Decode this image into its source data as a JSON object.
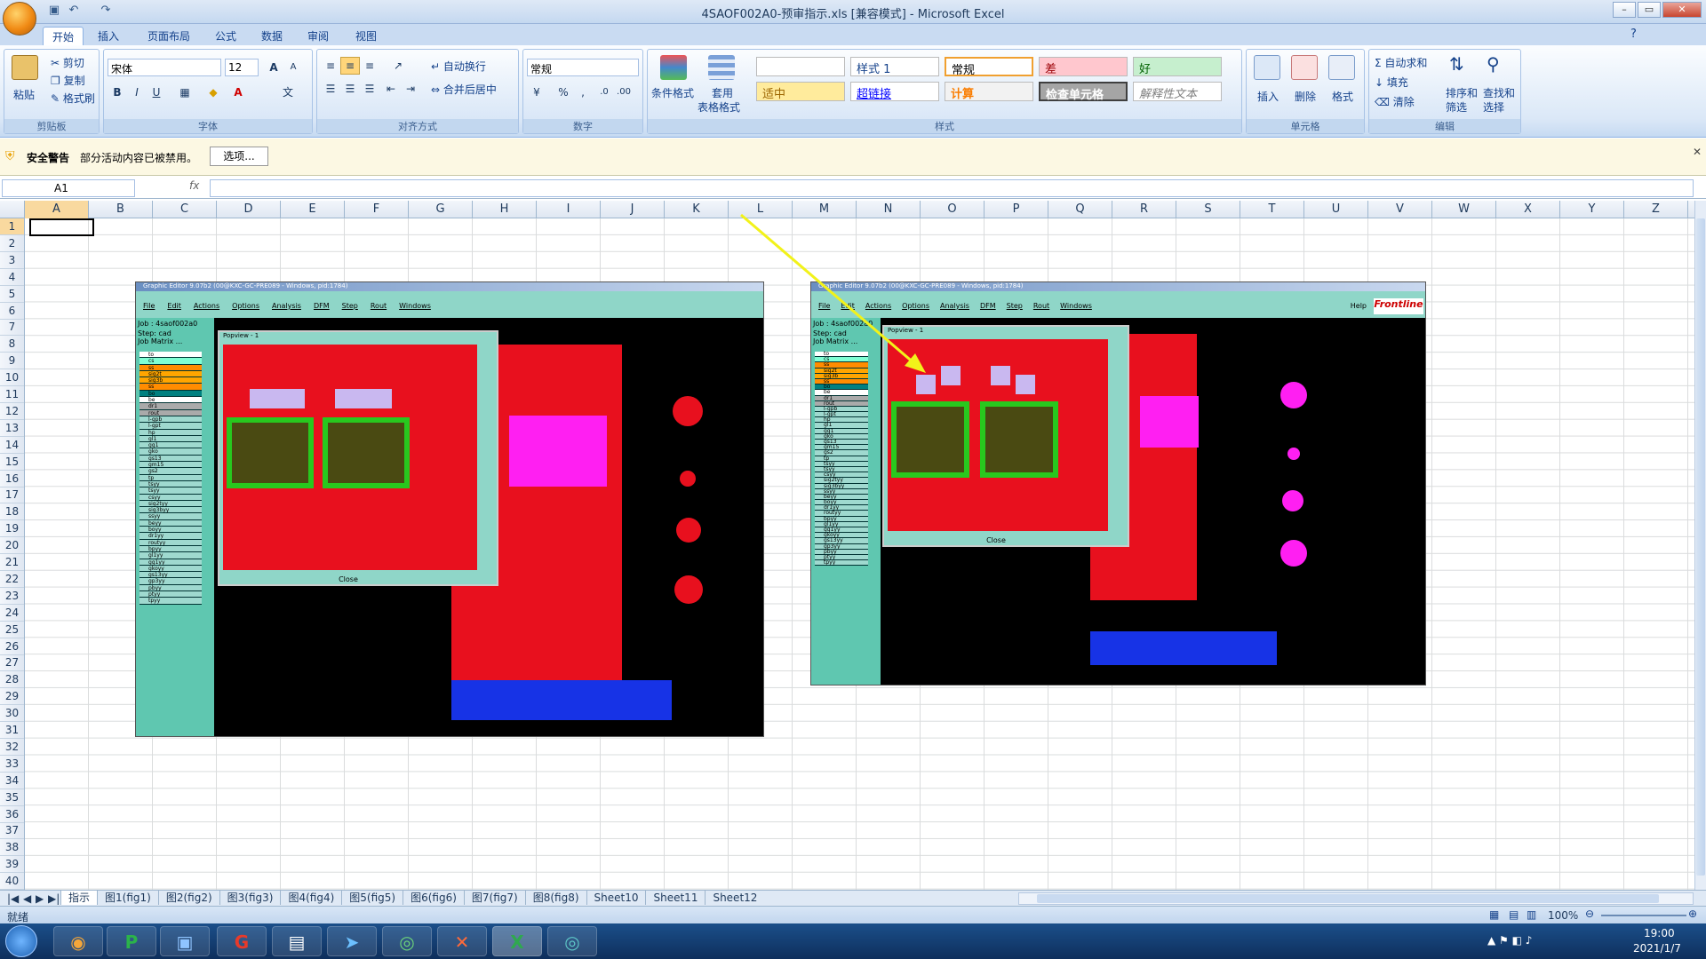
{
  "window": {
    "title": "4SAOF002A0-预审指示.xls  [兼容模式] - Microsoft Excel"
  },
  "ribbon": {
    "tabs": [
      "开始",
      "插入",
      "页面布局",
      "公式",
      "数据",
      "审阅",
      "视图"
    ],
    "clipboard": {
      "paste": "粘贴",
      "cut": "剪切",
      "copy": "复制",
      "format_painter": "格式刷",
      "label": "剪贴板"
    },
    "font": {
      "name": "宋体",
      "size": "12",
      "label": "字体"
    },
    "alignment": {
      "wrap": "自动换行",
      "merge": "合并后居中",
      "label": "对齐方式"
    },
    "number": {
      "format": "常规",
      "label": "数字"
    },
    "styles": {
      "cond_format": "条件格式",
      "table_format": "套用",
      "table_format2": "表格格式",
      "label": "样式",
      "cells": [
        "",
        "样式 1",
        "常规",
        "差",
        "好",
        "适中",
        "超链接",
        "计算",
        "检查单元格",
        "解释性文本"
      ]
    },
    "cells": {
      "insert": "插入",
      "delete": "删除",
      "format": "格式",
      "label": "单元格"
    },
    "editing": {
      "autosum": "自动求和",
      "fill": "填充",
      "clear": "清除",
      "sort": "排序和",
      "sort2": "筛选",
      "find": "查找和",
      "find2": "选择",
      "label": "编辑"
    }
  },
  "security": {
    "title": "安全警告",
    "message": "部分活动内容已被禁用。",
    "button": "选项..."
  },
  "formula": {
    "name_box": "A1",
    "fx": "fx",
    "value": ""
  },
  "columns": [
    "A",
    "B",
    "C",
    "D",
    "E",
    "F",
    "G",
    "H",
    "I",
    "J",
    "K",
    "L",
    "M",
    "N",
    "O",
    "P",
    "Q",
    "R",
    "S",
    "T",
    "U",
    "V",
    "W",
    "X",
    "Y",
    "Z"
  ],
  "rows": [
    "1",
    "2",
    "3",
    "4",
    "5",
    "6",
    "7",
    "8",
    "9",
    "10",
    "11",
    "12",
    "13",
    "14",
    "15",
    "16",
    "17",
    "18",
    "19",
    "20",
    "21",
    "22",
    "23",
    "24",
    "25",
    "26",
    "27",
    "28",
    "29",
    "30",
    "31",
    "32",
    "33",
    "34",
    "35",
    "36",
    "37",
    "38",
    "39",
    "40"
  ],
  "images": [
    {
      "title": "Graphic Editor 9.07b2 (00@KXC-GC-PRE089 - Windows, pid:1784)",
      "menu": [
        "File",
        "Edit",
        "Actions",
        "Options",
        "Analysis",
        "DFM",
        "Step",
        "Rout",
        "Windows"
      ],
      "job": "Job : 4saof002a0",
      "step": "Step: cad",
      "matrix": "Job Matrix ...",
      "popup_title": "Popview - 1",
      "close": "Close"
    },
    {
      "title": "Graphic Editor 9.07b2 (00@KXC-GC-PRE089 - Windows, pid:1784)",
      "menu": [
        "File",
        "Edit",
        "Actions",
        "Options",
        "Analysis",
        "DFM",
        "Step",
        "Rout",
        "Windows"
      ],
      "help": "Help",
      "brand": "Frontline",
      "job": "Job : 4saof002a0",
      "step": "Step: cad",
      "matrix": "Job Matrix ...",
      "popup_title": "Popview - 1",
      "close": "Close"
    }
  ],
  "layers": [
    "to",
    "cs",
    "ss",
    "sig2t",
    "sig3b",
    "ss",
    "bo",
    "be",
    "dr1",
    "rout",
    "l-gpb",
    "l-gpt",
    "hp",
    "gl1",
    "gg1",
    "gko",
    "gs13",
    "gm15",
    "gs2",
    "tp",
    "tsyy",
    "tsyy",
    "csyy",
    "sig2tyy",
    "sig3byy",
    "ssyy",
    "beyy",
    "boyy",
    "dr1yy",
    "routyy",
    "bpyy",
    "gl1yy",
    "gg1yy",
    "gkoyy",
    "gs13yy",
    "gp3yy",
    "pbyy",
    "ptyy",
    "tpyy"
  ],
  "sheets": [
    "指示",
    "图1(fig1)",
    "图2(fig2)",
    "图3(fig3)",
    "图4(fig4)",
    "图5(fig5)",
    "图6(fig6)",
    "图7(fig7)",
    "图8(fig8)",
    "Sheet10",
    "Sheet11",
    "Sheet12"
  ],
  "status": {
    "ready": "就绪",
    "zoom": "100%"
  },
  "taskbar": {
    "time": "19:00",
    "date": "2021/1/7"
  }
}
